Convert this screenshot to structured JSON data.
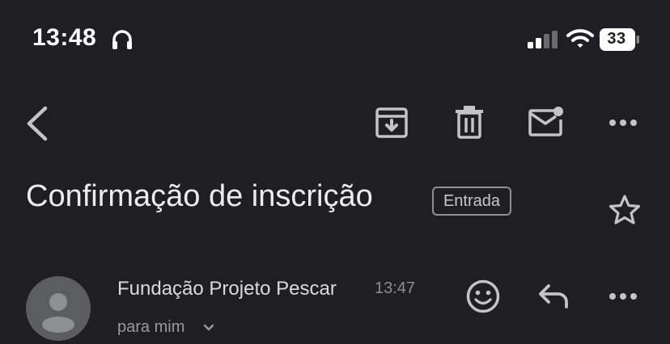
{
  "status_bar": {
    "time": "13:48",
    "battery": "33",
    "icons": [
      "headphones-icon",
      "cellular-signal-icon",
      "wifi-icon",
      "battery-icon"
    ]
  },
  "toolbar": {
    "icons": [
      "back-icon",
      "archive-icon",
      "trash-icon",
      "mark-unread-icon",
      "more-icon"
    ]
  },
  "email": {
    "subject": "Confirmação de inscrição",
    "label": "Entrada",
    "sender": "Fundação Projeto Pescar",
    "time": "13:47",
    "recipient": "para mim"
  },
  "colors": {
    "background": "#1f1f21",
    "icon": "#c4c4c7",
    "text": "#ececec",
    "avatar": "#5b5d61"
  }
}
